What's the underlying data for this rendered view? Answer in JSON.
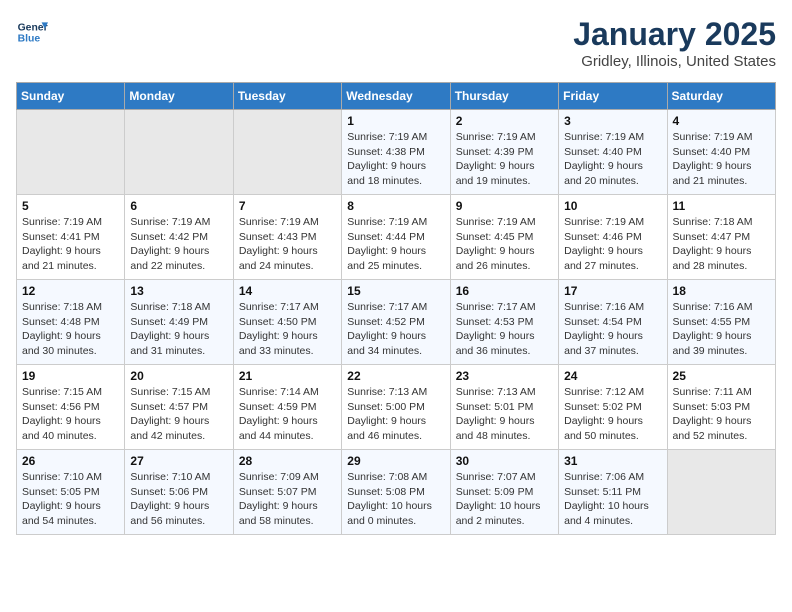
{
  "logo": {
    "line1": "General",
    "line2": "Blue"
  },
  "title": "January 2025",
  "subtitle": "Gridley, Illinois, United States",
  "days_of_week": [
    "Sunday",
    "Monday",
    "Tuesday",
    "Wednesday",
    "Thursday",
    "Friday",
    "Saturday"
  ],
  "weeks": [
    [
      {
        "day": "",
        "info": ""
      },
      {
        "day": "",
        "info": ""
      },
      {
        "day": "",
        "info": ""
      },
      {
        "day": "1",
        "info": "Sunrise: 7:19 AM\nSunset: 4:38 PM\nDaylight: 9 hours\nand 18 minutes."
      },
      {
        "day": "2",
        "info": "Sunrise: 7:19 AM\nSunset: 4:39 PM\nDaylight: 9 hours\nand 19 minutes."
      },
      {
        "day": "3",
        "info": "Sunrise: 7:19 AM\nSunset: 4:40 PM\nDaylight: 9 hours\nand 20 minutes."
      },
      {
        "day": "4",
        "info": "Sunrise: 7:19 AM\nSunset: 4:40 PM\nDaylight: 9 hours\nand 21 minutes."
      }
    ],
    [
      {
        "day": "5",
        "info": "Sunrise: 7:19 AM\nSunset: 4:41 PM\nDaylight: 9 hours\nand 21 minutes."
      },
      {
        "day": "6",
        "info": "Sunrise: 7:19 AM\nSunset: 4:42 PM\nDaylight: 9 hours\nand 22 minutes."
      },
      {
        "day": "7",
        "info": "Sunrise: 7:19 AM\nSunset: 4:43 PM\nDaylight: 9 hours\nand 24 minutes."
      },
      {
        "day": "8",
        "info": "Sunrise: 7:19 AM\nSunset: 4:44 PM\nDaylight: 9 hours\nand 25 minutes."
      },
      {
        "day": "9",
        "info": "Sunrise: 7:19 AM\nSunset: 4:45 PM\nDaylight: 9 hours\nand 26 minutes."
      },
      {
        "day": "10",
        "info": "Sunrise: 7:19 AM\nSunset: 4:46 PM\nDaylight: 9 hours\nand 27 minutes."
      },
      {
        "day": "11",
        "info": "Sunrise: 7:18 AM\nSunset: 4:47 PM\nDaylight: 9 hours\nand 28 minutes."
      }
    ],
    [
      {
        "day": "12",
        "info": "Sunrise: 7:18 AM\nSunset: 4:48 PM\nDaylight: 9 hours\nand 30 minutes."
      },
      {
        "day": "13",
        "info": "Sunrise: 7:18 AM\nSunset: 4:49 PM\nDaylight: 9 hours\nand 31 minutes."
      },
      {
        "day": "14",
        "info": "Sunrise: 7:17 AM\nSunset: 4:50 PM\nDaylight: 9 hours\nand 33 minutes."
      },
      {
        "day": "15",
        "info": "Sunrise: 7:17 AM\nSunset: 4:52 PM\nDaylight: 9 hours\nand 34 minutes."
      },
      {
        "day": "16",
        "info": "Sunrise: 7:17 AM\nSunset: 4:53 PM\nDaylight: 9 hours\nand 36 minutes."
      },
      {
        "day": "17",
        "info": "Sunrise: 7:16 AM\nSunset: 4:54 PM\nDaylight: 9 hours\nand 37 minutes."
      },
      {
        "day": "18",
        "info": "Sunrise: 7:16 AM\nSunset: 4:55 PM\nDaylight: 9 hours\nand 39 minutes."
      }
    ],
    [
      {
        "day": "19",
        "info": "Sunrise: 7:15 AM\nSunset: 4:56 PM\nDaylight: 9 hours\nand 40 minutes."
      },
      {
        "day": "20",
        "info": "Sunrise: 7:15 AM\nSunset: 4:57 PM\nDaylight: 9 hours\nand 42 minutes."
      },
      {
        "day": "21",
        "info": "Sunrise: 7:14 AM\nSunset: 4:59 PM\nDaylight: 9 hours\nand 44 minutes."
      },
      {
        "day": "22",
        "info": "Sunrise: 7:13 AM\nSunset: 5:00 PM\nDaylight: 9 hours\nand 46 minutes."
      },
      {
        "day": "23",
        "info": "Sunrise: 7:13 AM\nSunset: 5:01 PM\nDaylight: 9 hours\nand 48 minutes."
      },
      {
        "day": "24",
        "info": "Sunrise: 7:12 AM\nSunset: 5:02 PM\nDaylight: 9 hours\nand 50 minutes."
      },
      {
        "day": "25",
        "info": "Sunrise: 7:11 AM\nSunset: 5:03 PM\nDaylight: 9 hours\nand 52 minutes."
      }
    ],
    [
      {
        "day": "26",
        "info": "Sunrise: 7:10 AM\nSunset: 5:05 PM\nDaylight: 9 hours\nand 54 minutes."
      },
      {
        "day": "27",
        "info": "Sunrise: 7:10 AM\nSunset: 5:06 PM\nDaylight: 9 hours\nand 56 minutes."
      },
      {
        "day": "28",
        "info": "Sunrise: 7:09 AM\nSunset: 5:07 PM\nDaylight: 9 hours\nand 58 minutes."
      },
      {
        "day": "29",
        "info": "Sunrise: 7:08 AM\nSunset: 5:08 PM\nDaylight: 10 hours\nand 0 minutes."
      },
      {
        "day": "30",
        "info": "Sunrise: 7:07 AM\nSunset: 5:09 PM\nDaylight: 10 hours\nand 2 minutes."
      },
      {
        "day": "31",
        "info": "Sunrise: 7:06 AM\nSunset: 5:11 PM\nDaylight: 10 hours\nand 4 minutes."
      },
      {
        "day": "",
        "info": ""
      }
    ]
  ]
}
